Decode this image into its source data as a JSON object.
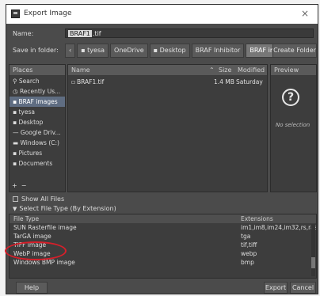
{
  "window": {
    "title": "Export Image",
    "close_glyph": "×"
  },
  "name_field": {
    "label": "Name:",
    "selected_part": "BRAF1",
    "rest": ".tif"
  },
  "save_in": {
    "label": "Save in folder:",
    "crumbs": [
      "‹",
      "tyesa",
      "OneDrive",
      "Desktop",
      "BRAF Inhibitor",
      "BRAF images"
    ],
    "create_folder_label": "Create Folder"
  },
  "places": {
    "header": "Places",
    "items": [
      "Search",
      "Recently Us...",
      "BRAF images",
      "tyesa",
      "Desktop",
      "Google Driv...",
      "Windows (C:)",
      "Pictures",
      "Documents"
    ],
    "selected": 2,
    "add_glyph": "+",
    "remove_glyph": "−"
  },
  "files": {
    "col_name": "Name",
    "col_size": "Size",
    "col_modified": "Modified",
    "sort_glyph": "⌃",
    "rows": [
      {
        "name": "BRAF1.tif",
        "size": "1.4 MB",
        "modified": "Saturday"
      }
    ]
  },
  "preview": {
    "header": "Preview",
    "icon_glyph": "?",
    "text": "No selection"
  },
  "options": {
    "show_all_files": "Show All Files",
    "select_type": "Select File Type (By Extension)"
  },
  "file_types": {
    "col_type": "File Type",
    "col_ext": "Extensions",
    "rows": [
      {
        "type": "SUN Rasterfile image",
        "ext": "im1,im8,im24,im32,rs,ras"
      },
      {
        "type": "TarGA image",
        "ext": "tga"
      },
      {
        "type": "TIFF image",
        "ext": "tif,tiff"
      },
      {
        "type": "WebP image",
        "ext": "webp"
      },
      {
        "type": "Windows BMP image",
        "ext": "bmp"
      }
    ]
  },
  "buttons": {
    "help": "Help",
    "export": "Export",
    "cancel": "Cancel"
  },
  "colors": {
    "annotation_ellipse": "#d61f2a",
    "selection": "#5f6d82"
  }
}
